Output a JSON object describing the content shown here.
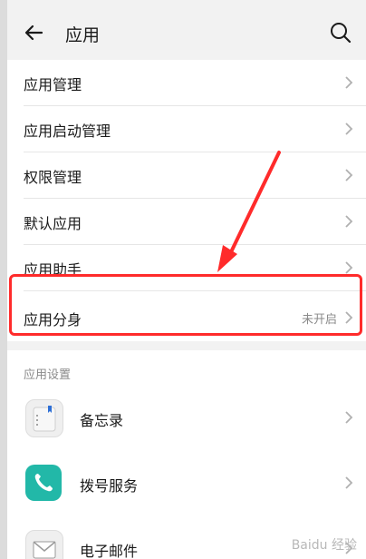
{
  "header": {
    "title": "应用"
  },
  "menu": {
    "items": [
      {
        "label": "应用管理",
        "value": ""
      },
      {
        "label": "应用启动管理",
        "value": ""
      },
      {
        "label": "权限管理",
        "value": ""
      },
      {
        "label": "默认应用",
        "value": ""
      },
      {
        "label": "应用助手",
        "value": ""
      },
      {
        "label": "应用分身",
        "value": "未开启"
      }
    ]
  },
  "settings": {
    "section_title": "应用设置",
    "apps": [
      {
        "label": "备忘录",
        "icon": "memo-icon"
      },
      {
        "label": "拨号服务",
        "icon": "phone-icon"
      },
      {
        "label": "电子邮件",
        "icon": "mail-icon"
      }
    ]
  },
  "annotation": {
    "highlight_color": "#ff2b2b"
  },
  "watermark": "Baidu 经验"
}
